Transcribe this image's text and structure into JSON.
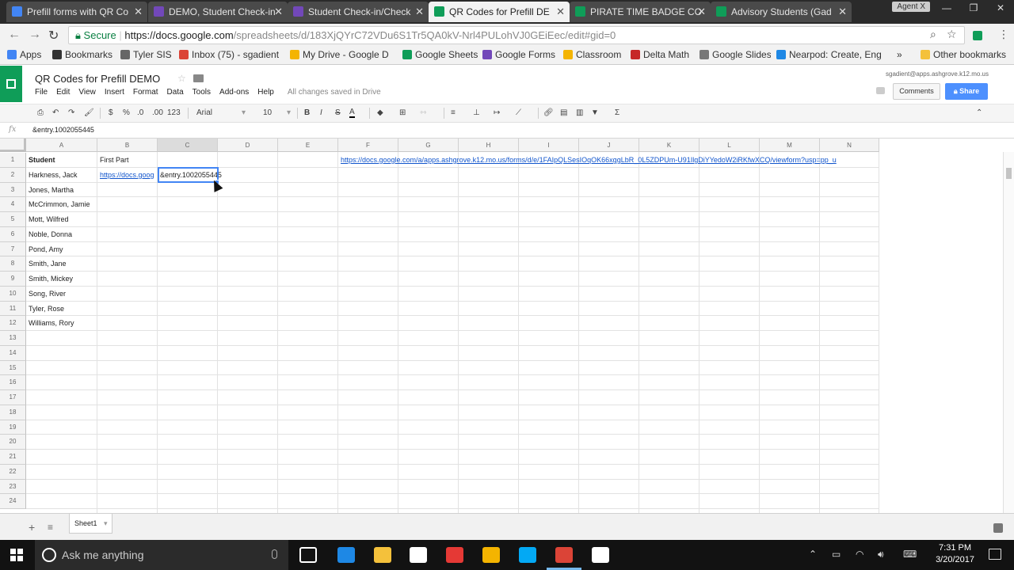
{
  "browser": {
    "tabs": [
      {
        "title": "Prefill forms with QR Co",
        "color": "#4285f4"
      },
      {
        "title": "DEMO, Student Check-in",
        "color": "#7248b9"
      },
      {
        "title": "Student Check-in/Check",
        "color": "#7248b9"
      },
      {
        "title": "QR Codes for Prefill DE",
        "color": "#0f9d58",
        "active": true
      },
      {
        "title": "PIRATE TIME BADGE CO",
        "color": "#0f9d58"
      },
      {
        "title": "Advisory Students (Gad",
        "color": "#0f9d58"
      }
    ],
    "profile": "Agent X",
    "secure_label": "Secure",
    "url_host": "https://docs.google.com",
    "url_path": "/spreadsheets/d/183XjQYrC72VDu6S1Tr5QA0kV-Nrl4PULohVJ0GEiEec/edit#gid=0",
    "bookmarks": [
      {
        "label": "Apps",
        "color": "#4285f4"
      },
      {
        "label": "Bookmarks",
        "color": "#333333"
      },
      {
        "label": "Tyler SIS",
        "color": "#666666"
      },
      {
        "label": "Inbox (75) - sgadient",
        "color": "#db4437"
      },
      {
        "label": "My Drive - Google D",
        "color": "#f4b400"
      },
      {
        "label": "Google Sheets",
        "color": "#0f9d58"
      },
      {
        "label": "Google Forms",
        "color": "#7248b9"
      },
      {
        "label": "Classroom",
        "color": "#f4b400"
      },
      {
        "label": "Delta Math",
        "color": "#c62828"
      },
      {
        "label": "Google Slides",
        "color": "#777777"
      },
      {
        "label": "Nearpod: Create, Eng",
        "color": "#1e88e5"
      }
    ],
    "more_bookmarks": "»",
    "other_bookmarks": "Other bookmarks"
  },
  "sheets": {
    "title": "QR Codes for Prefill DEMO",
    "menu": [
      "File",
      "Edit",
      "View",
      "Insert",
      "Format",
      "Data",
      "Tools",
      "Add-ons",
      "Help"
    ],
    "save_status": "All changes saved in Drive",
    "user_email": "sgadient@apps.ashgrove.k12.mo.us",
    "comments_label": "Comments",
    "share_label": "Share",
    "toolbar": {
      "currency": "$",
      "percent": "%",
      "dec_decrease": ".0",
      "dec_increase": ".00",
      "more_formats": "123",
      "font": "Arial",
      "font_size": "10",
      "bold": "B",
      "italic": "I",
      "strike": "S",
      "text_color": "A",
      "functions": "Σ"
    },
    "formula_bar": {
      "fx": "fx",
      "value": "&entry.1002055445"
    },
    "columns": [
      "A",
      "B",
      "C",
      "D",
      "E",
      "F",
      "G",
      "H",
      "I",
      "J",
      "K",
      "L",
      "M",
      "N"
    ],
    "rows": [
      "1",
      "2",
      "3",
      "4",
      "5",
      "6",
      "7",
      "8",
      "9",
      "10",
      "11",
      "12",
      "13",
      "14",
      "15",
      "16",
      "17",
      "18",
      "19",
      "20",
      "21",
      "22",
      "23",
      "24"
    ],
    "header_student": "Student",
    "header_first_part": "First Part",
    "f1_link": "https://docs.google.com/a/apps.ashgrove.k12.mo.us/forms/d/e/1FAIpQLSesIOqOK66xggLbR_0L5ZDPUm-U91IlgDiYYedoW2iRKfwXCQ/viewform?usp=pp_u",
    "b2_value": "https://docs.goog",
    "c2_value": "&entry.1002055445",
    "students": [
      "Harkness, Jack",
      "Jones, Martha",
      "McCrimmon, Jamie",
      "Mott, Wilfred",
      "Noble, Donna",
      "Pond, Amy",
      "Smith, Jane",
      "Smith, Mickey",
      "Song, River",
      "Tyler, Rose",
      "Williams, Rory"
    ],
    "sheet_tab": "Sheet1"
  },
  "taskbar": {
    "search_placeholder": "Ask me anything",
    "time": "7:31 PM",
    "date": "3/20/2017",
    "apps": [
      {
        "name": "task-view",
        "color": "#121212"
      },
      {
        "name": "edge",
        "color": "#1e88e5"
      },
      {
        "name": "file-explorer",
        "color": "#f4c13b"
      },
      {
        "name": "store",
        "color": "#ffffff"
      },
      {
        "name": "acrobat",
        "color": "#e53935"
      },
      {
        "name": "norton",
        "color": "#f4b400"
      },
      {
        "name": "skype",
        "color": "#03a9f4"
      },
      {
        "name": "chrome",
        "color": "#db4437"
      },
      {
        "name": "camtasia",
        "color": "#ffffff"
      }
    ]
  }
}
